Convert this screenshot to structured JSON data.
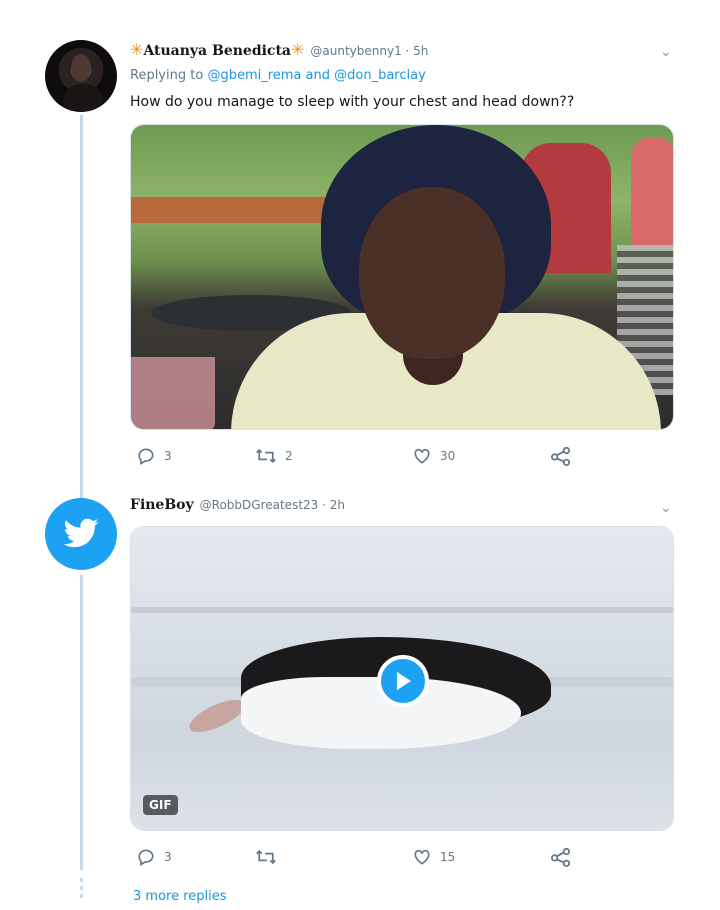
{
  "tweet1": {
    "star_left": "✳",
    "name": "Atuanya Benedicta",
    "star_right": "✳",
    "handle": "@auntybenny1 · 5h",
    "replying_prefix": "Replying to",
    "replying_to": "@gbemi_rema and @don_barclay",
    "text": "How do you manage to sleep with your chest and head down??",
    "counts": {
      "replies": "3",
      "retweets": "2",
      "likes": "30"
    }
  },
  "tweet2": {
    "name": "FineBoy",
    "handle": "@RobbDGreatest23 · 2h",
    "gif_label": "GIF",
    "counts": {
      "replies": "3",
      "retweets": "",
      "likes": "15"
    }
  },
  "more_replies": "3 more replies",
  "colors": {
    "accent": "#1da1f2",
    "link": "#1b95e0",
    "muted": "#657786",
    "thread": "#c4d9ea"
  },
  "icons": [
    "reply-icon",
    "retweet-icon",
    "like-icon",
    "share-icon",
    "chevron-down-icon",
    "play-icon",
    "twitter-bird-icon"
  ]
}
